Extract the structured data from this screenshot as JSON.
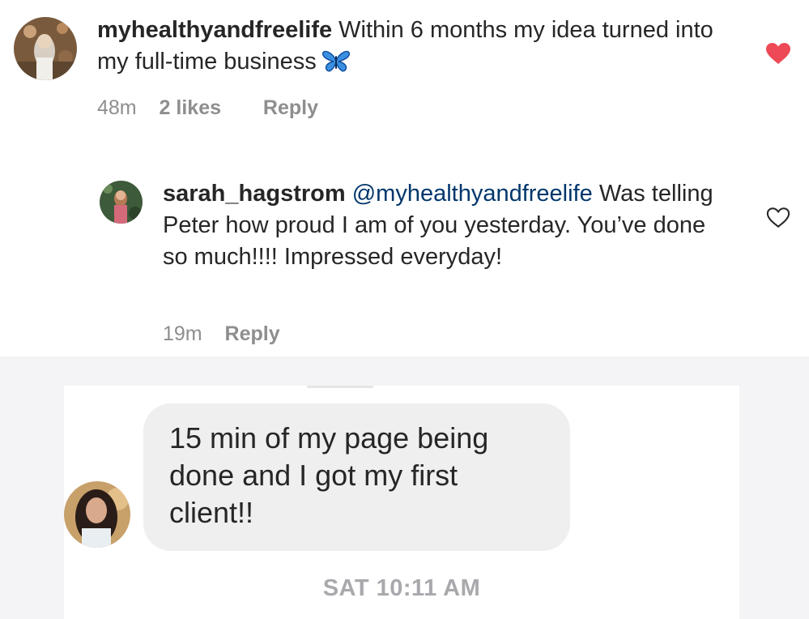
{
  "comments": [
    {
      "username": "myhealthyandfreelife",
      "text": "Within 6 months my idea turned into my full-time business",
      "emoji": "butterfly-emoji",
      "time": "48m",
      "likes": "2 likes",
      "reply_label": "Reply",
      "liked": true,
      "heart_color": "#ed4956"
    },
    {
      "username": "sarah_hagstrom",
      "mention": "@myhealthyandfreelife",
      "text": "Was telling Peter how proud I am of you yesterday. You’ve done so much!!!! Impressed everyday!",
      "time": "19m",
      "reply_label": "Reply",
      "liked": false
    }
  ],
  "dm": {
    "message": "15 min of my page being done and I got my first client!!",
    "timestamp": "SAT 10:11 AM"
  },
  "colors": {
    "text": "#262626",
    "muted": "#8e8e8e",
    "mention": "#00376b",
    "heart_liked": "#ed4956",
    "bubble": "#efefef",
    "dm_background": "#f4f4f6"
  }
}
